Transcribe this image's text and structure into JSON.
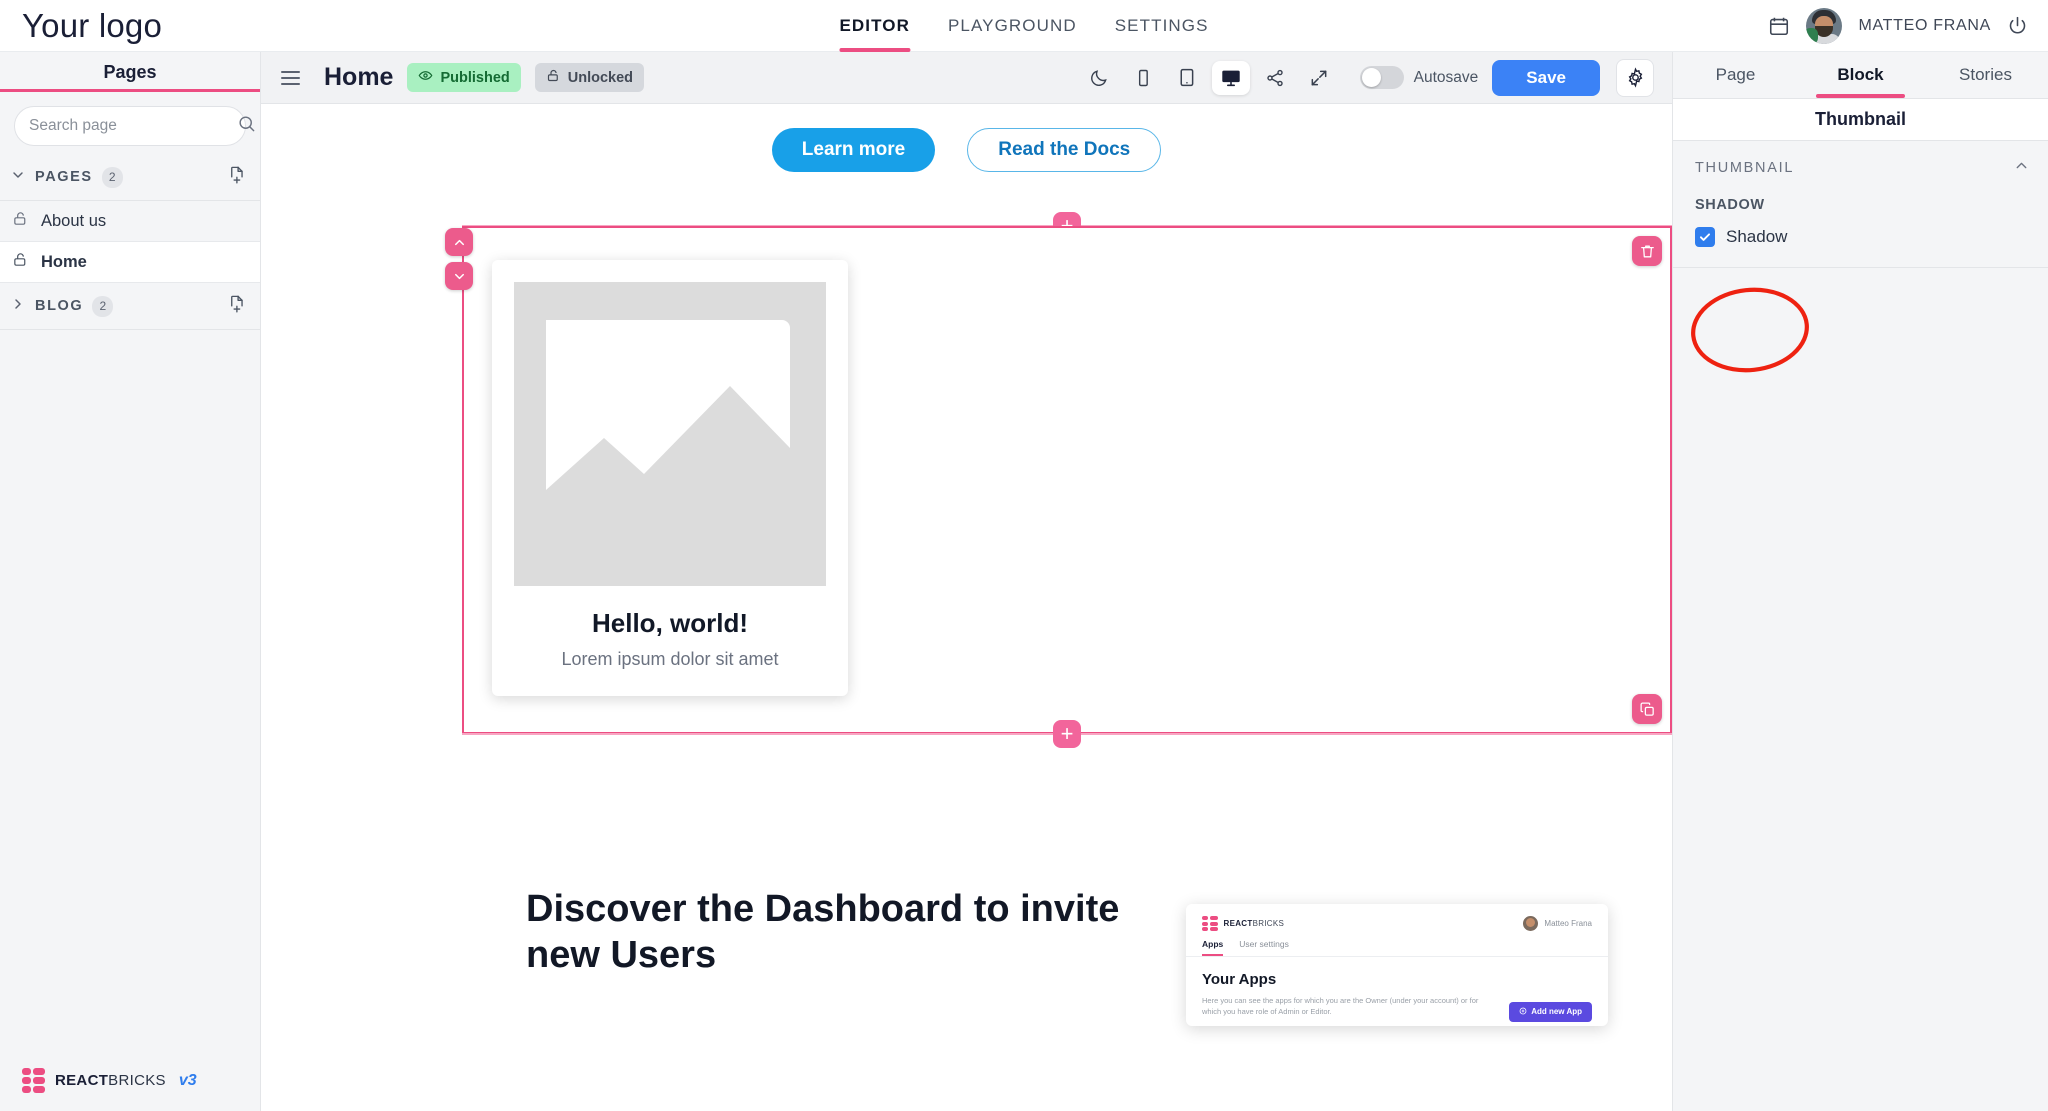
{
  "topbar": {
    "logo": "Your logo",
    "tabs": [
      {
        "label": "EDITOR",
        "active": true
      },
      {
        "label": "PLAYGROUND",
        "active": false
      },
      {
        "label": "SETTINGS",
        "active": false
      }
    ],
    "calendar_icon": "calendar-icon",
    "user_name": "MATTEO FRANA",
    "logout_icon": "power-icon"
  },
  "sidebar": {
    "title": "Pages",
    "search": {
      "placeholder": "Search page",
      "value": ""
    },
    "sections": [
      {
        "label": "PAGES",
        "count": "2",
        "expanded": true
      },
      {
        "label": "BLOG",
        "count": "2",
        "expanded": false
      }
    ],
    "pages": [
      {
        "label": "About us",
        "selected": false,
        "lock": "unlock-icon"
      },
      {
        "label": "Home",
        "selected": true,
        "lock": "unlock-icon"
      }
    ],
    "footer": {
      "brand_bold": "REACT",
      "brand_light": "BRICKS",
      "version": "v3"
    }
  },
  "toolbar": {
    "page_title": "Home",
    "status_badge": "Published",
    "lock_badge": "Unlocked",
    "view_buttons": [
      {
        "name": "dark-mode-icon",
        "active": false
      },
      {
        "name": "mobile-view-icon",
        "active": false
      },
      {
        "name": "tablet-view-icon",
        "active": false
      },
      {
        "name": "desktop-view-icon",
        "active": true
      },
      {
        "name": "share-icon",
        "active": false
      },
      {
        "name": "fullscreen-icon",
        "active": false
      }
    ],
    "autosave_label": "Autosave",
    "autosave_on": false,
    "save_label": "Save",
    "settings_icon": "gear-icon"
  },
  "canvas": {
    "hero_buttons": [
      {
        "label": "Learn more",
        "style": "primary"
      },
      {
        "label": "Read the Docs",
        "style": "outline"
      }
    ],
    "card": {
      "title": "Hello, world!",
      "subtitle": "Lorem ipsum dolor sit amet",
      "image_placeholder": "image-placeholder-icon"
    },
    "block_controls": {
      "move_up": "chevron-up-icon",
      "move_down": "chevron-down-icon",
      "delete": "trash-icon",
      "duplicate": "duplicate-icon",
      "add_above": "+",
      "add_below": "+"
    },
    "bottom_section": {
      "heading": "Discover the Dashboard to invite new Users",
      "dashboard": {
        "brand_bold": "REACT",
        "brand_light": "BRICKS",
        "user_name": "Matteo Frana",
        "tabs": [
          {
            "label": "Apps",
            "active": true
          },
          {
            "label": "User settings",
            "active": false
          }
        ],
        "heading": "Your Apps",
        "paragraph": "Here you can see the apps for which you are the Owner (under your account) or for which you have role of Admin or Editor.",
        "cta": "Add new App"
      }
    }
  },
  "right_panel": {
    "tabs": [
      {
        "label": "Page",
        "active": false
      },
      {
        "label": "Block",
        "active": true
      },
      {
        "label": "Stories",
        "active": false
      }
    ],
    "title": "Thumbnail",
    "section_label": "THUMBNAIL",
    "collapse_icon": "chevron-up-icon",
    "group_label": "SHADOW",
    "checkbox_label": "Shadow",
    "checkbox_checked": true,
    "annotation": {
      "shape": "ellipse",
      "color": "#ee2211"
    }
  }
}
